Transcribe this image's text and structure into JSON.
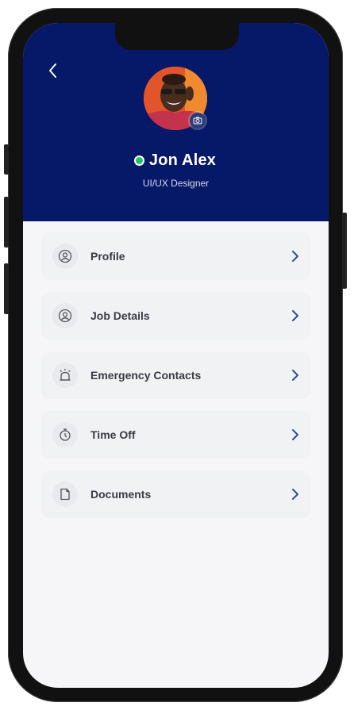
{
  "profile": {
    "name": "Jon Alex",
    "role": "UI/UX Designer",
    "status": "online",
    "status_color": "#27c06a",
    "header_color": "#061868"
  },
  "menu": [
    {
      "label": "Profile",
      "icon": "user-circle-icon"
    },
    {
      "label": "Job Details",
      "icon": "user-circle-icon"
    },
    {
      "label": "Emergency Contacts",
      "icon": "alarm-icon"
    },
    {
      "label": "Time Off",
      "icon": "stopwatch-icon"
    },
    {
      "label": "Documents",
      "icon": "document-icon"
    }
  ],
  "colors": {
    "accent_chevron": "#2a4ea0",
    "label_text": "#3a3a44"
  }
}
